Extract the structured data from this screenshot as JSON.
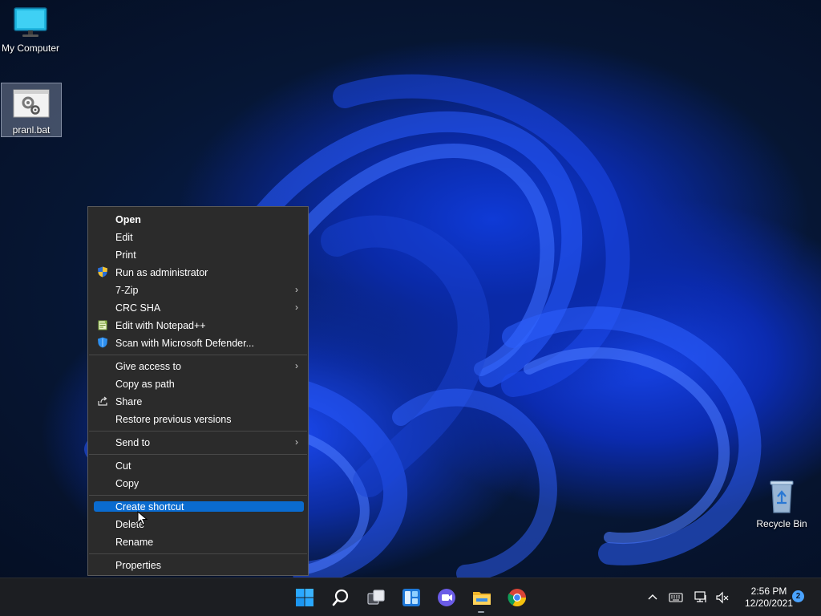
{
  "desktop": {
    "icons": [
      {
        "label": "My Computer",
        "icon": "monitor-icon"
      },
      {
        "label": "pranl.bat",
        "icon": "batch-file-icon",
        "selected": true
      },
      {
        "label": "Recycle Bin",
        "icon": "recycle-bin-icon"
      }
    ]
  },
  "context_menu": {
    "items": [
      {
        "label": "Open",
        "bold": true
      },
      {
        "label": "Edit"
      },
      {
        "label": "Print"
      },
      {
        "label": "Run as administrator",
        "icon": "uac-shield-icon"
      },
      {
        "label": "7-Zip",
        "submenu": true
      },
      {
        "label": "CRC SHA",
        "submenu": true
      },
      {
        "label": "Edit with Notepad++",
        "icon": "notepad-plus-plus-icon"
      },
      {
        "label": "Scan with Microsoft Defender...",
        "icon": "defender-shield-icon"
      },
      {
        "label": "Give access to",
        "submenu": true
      },
      {
        "label": "Copy as path"
      },
      {
        "label": "Share",
        "icon": "share-icon"
      },
      {
        "label": "Restore previous versions"
      },
      {
        "label": "Send to",
        "submenu": true
      },
      {
        "label": "Cut"
      },
      {
        "label": "Copy"
      },
      {
        "label": "Create shortcut",
        "highlighted": true
      },
      {
        "label": "Delete"
      },
      {
        "label": "Rename"
      },
      {
        "label": "Properties"
      }
    ],
    "submenu_arrow": "›",
    "highlight_color": "#0a6bcf"
  },
  "taskbar": {
    "apps": [
      "start-icon",
      "search-icon",
      "task-view-icon",
      "widgets-icon",
      "chat-icon",
      "file-explorer-icon",
      "chrome-icon"
    ],
    "tray": {
      "overflow_arrow": "^",
      "time": "2:56 PM",
      "date": "12/20/2021",
      "notification_count": "2"
    }
  }
}
